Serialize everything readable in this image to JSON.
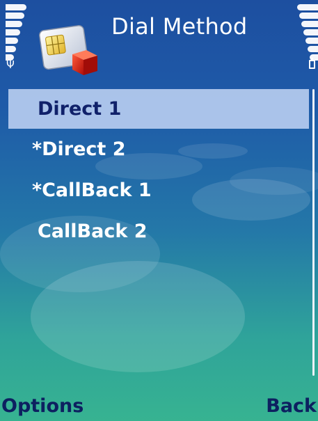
{
  "header": {
    "title": "Dial Method",
    "app_icon": "sim-card-icon",
    "signal_icon": "signal-strength-icon",
    "battery_icon": "battery-level-icon",
    "antenna_glyph": "Ψ"
  },
  "list": {
    "items": [
      {
        "label": "Direct 1",
        "selected": true
      },
      {
        "label": "*Direct 2",
        "selected": false
      },
      {
        "label": "*CallBack 1",
        "selected": false
      },
      {
        "label": "CallBack 2",
        "selected": false
      }
    ]
  },
  "softkeys": {
    "left": "Options",
    "right": "Back"
  },
  "colors": {
    "background_top": "#1d4fa0",
    "background_bottom": "#37b391",
    "highlight": "#bed2f2",
    "softkey_text": "#0d2060"
  }
}
